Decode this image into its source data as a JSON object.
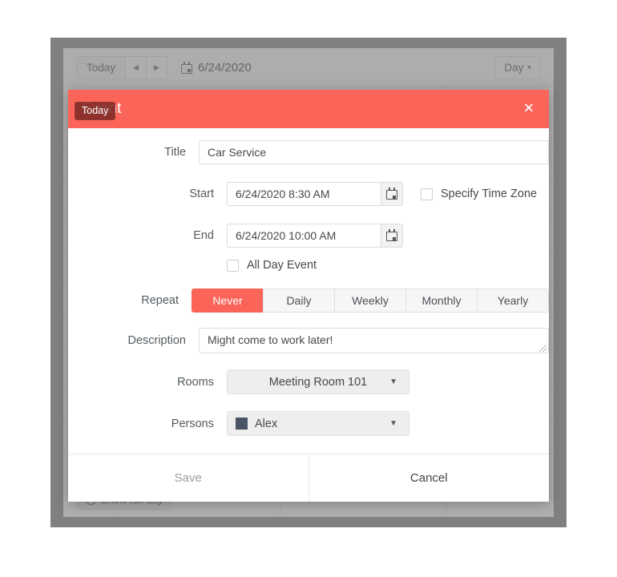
{
  "toolbar": {
    "today_label": "Today",
    "prev_icon": "chevron-left-icon",
    "next_icon": "chevron-right-icon",
    "prev_glyph": "◀",
    "next_glyph": "▶",
    "date_icon": "calendar-icon",
    "date_text": "6/24/2020",
    "view_label": "Day",
    "view_caret": "▾"
  },
  "calendar": {
    "show_full_day_label": "Show full day",
    "show_full_day_icon": "clock-icon"
  },
  "tooltip": {
    "text": "Today"
  },
  "dialog": {
    "title": "Event",
    "close_glyph": "✕",
    "header_color": "#fb6459",
    "fields": {
      "title": {
        "label": "Title",
        "value": "Car Service"
      },
      "start": {
        "label": "Start",
        "value": "6/24/2020 8:30 AM",
        "picker_icon": "calendar-icon"
      },
      "end": {
        "label": "End",
        "value": "6/24/2020 10:00 AM",
        "picker_icon": "calendar-icon"
      },
      "timezone": {
        "label": "Specify Time Zone",
        "checked": false
      },
      "allday": {
        "label": "All Day Event",
        "checked": false
      },
      "repeat": {
        "label": "Repeat",
        "options": [
          "Never",
          "Daily",
          "Weekly",
          "Monthly",
          "Yearly"
        ],
        "selected": "Never"
      },
      "description": {
        "label": "Description",
        "value": "Might come to work later!"
      },
      "rooms": {
        "label": "Rooms",
        "value": "Meeting Room 101",
        "caret": "▼"
      },
      "persons": {
        "label": "Persons",
        "value": "Alex",
        "caret": "▼",
        "color": "#4a5568"
      }
    },
    "footer": {
      "save_label": "Save",
      "cancel_label": "Cancel"
    }
  }
}
